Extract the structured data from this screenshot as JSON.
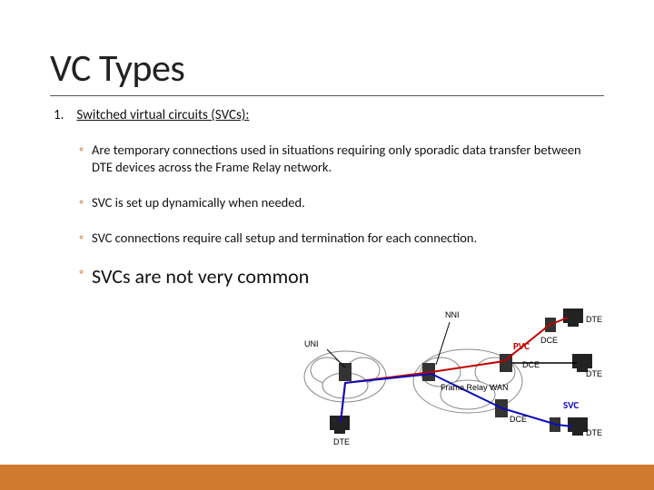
{
  "title": "VC Types",
  "list": {
    "number": "1.",
    "heading": "Switched virtual circuits (SVCs):"
  },
  "bullets": {
    "b1": "Are temporary connections used in situations requiring only  sporadic data transfer between DTE devices across the Frame Relay network.",
    "b2": "SVC is set up dynamically when needed.",
    "b3": "SVC connections require call setup and termination for each connection.",
    "b4": "SVCs are not very common"
  },
  "diagram": {
    "labels": {
      "uni": "UNI",
      "nni": "NNI",
      "pvc": "PVC",
      "svc": "SVC",
      "dce": "DCE",
      "dte": "DTE",
      "wan": "Frame Relay WAN"
    }
  },
  "colors": {
    "accent": "#cf7b2f",
    "pvc": "#c00000",
    "svc": "#0b0bbf"
  }
}
